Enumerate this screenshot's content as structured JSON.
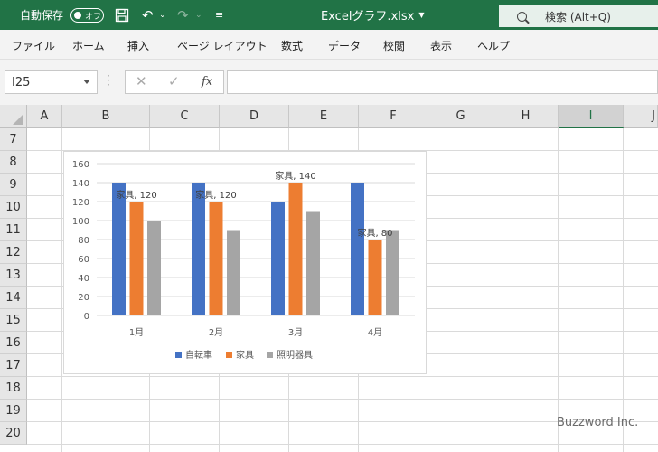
{
  "titlebar": {
    "autosave_label": "自動保存",
    "autosave_state": "オフ",
    "filename": "Excelグラフ.xlsx",
    "search_placeholder": "検索 (Alt+Q)"
  },
  "ribbon": {
    "tabs": [
      "ファイル",
      "ホーム",
      "挿入",
      "ページ レイアウト",
      "数式",
      "データ",
      "校閲",
      "表示",
      "ヘルプ"
    ]
  },
  "formula_bar": {
    "name_box": "I25",
    "formula": ""
  },
  "sheet": {
    "columns": [
      "A",
      "B",
      "C",
      "D",
      "E",
      "F",
      "G",
      "H",
      "I",
      "J"
    ],
    "selected_column": "I",
    "rows": [
      "7",
      "8",
      "9",
      "10",
      "11",
      "12",
      "13",
      "14",
      "15",
      "16",
      "17",
      "18",
      "19",
      "20"
    ]
  },
  "colors": {
    "excel_green": "#217346",
    "series_bicycle": "#4472c4",
    "series_furniture": "#ed7d31",
    "series_lighting": "#a5a5a5"
  },
  "chart_data": {
    "type": "bar",
    "categories": [
      "1月",
      "2月",
      "3月",
      "4月"
    ],
    "series": [
      {
        "name": "自転車",
        "values": [
          140,
          140,
          120,
          140
        ]
      },
      {
        "name": "家具",
        "values": [
          120,
          120,
          140,
          80
        ]
      },
      {
        "name": "照明器具",
        "values": [
          100,
          90,
          110,
          90
        ]
      }
    ],
    "ylim": [
      0,
      160
    ],
    "yticks": [
      "0",
      "20",
      "40",
      "60",
      "80",
      "100",
      "120",
      "140",
      "160"
    ],
    "data_labels": [
      "家具, 120",
      "家具, 120",
      "家具, 140",
      "家具, 80"
    ],
    "legend_position": "bottom",
    "grid": true
  },
  "watermark": "Buzzword Inc."
}
